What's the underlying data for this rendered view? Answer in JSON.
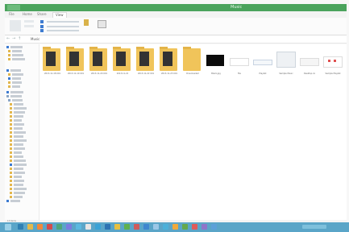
{
  "window": {
    "title": "Music",
    "tabs": [
      {
        "label": "File"
      },
      {
        "label": "Home"
      },
      {
        "label": "Share"
      },
      {
        "label": "View"
      }
    ],
    "active_tab": "Picture Tools"
  },
  "address": {
    "path": "Music"
  },
  "navigation": {
    "items": [
      "Favourites",
      "Desktop",
      "Downloads",
      "Recent places",
      "",
      "Libraries",
      "Documents",
      "Music",
      "Pictures",
      "Videos",
      "",
      "Homegroup",
      "",
      "Computer",
      "Local Disk",
      "",
      "",
      "",
      "",
      "",
      "",
      "",
      "",
      "",
      "",
      "",
      "",
      "",
      "",
      "",
      "",
      "",
      "",
      "",
      "",
      "",
      "",
      "",
      "Network",
      "",
      "",
      "",
      "",
      ""
    ]
  },
  "content": {
    "tiles": [
      {
        "kind": "folder",
        "label": "2013-11-18 001"
      },
      {
        "kind": "folder",
        "label": "2013-11-19 001"
      },
      {
        "kind": "folder",
        "label": "2013-11-20 001"
      },
      {
        "kind": "folder",
        "label": "2013-11-21"
      },
      {
        "kind": "folder",
        "label": "2013-11-22 001"
      },
      {
        "kind": "folder",
        "label": "2013-11-23 001"
      },
      {
        "kind": "folder",
        "label": "Downloaded"
      },
      {
        "kind": "black",
        "label": "Black.jpg"
      },
      {
        "kind": "file",
        "label": "file"
      },
      {
        "kind": "file",
        "label": "Playlist"
      },
      {
        "kind": "file",
        "label": "Sample Music"
      },
      {
        "kind": "file",
        "label": "Desktop.ini"
      },
      {
        "kind": "file",
        "label": "Sample Playlist"
      }
    ]
  },
  "status": {
    "text": "13 items"
  },
  "colors": {
    "titlebar": "#4aa35c",
    "taskbar": "#5aa5c8",
    "folder": "#f0c45a"
  }
}
